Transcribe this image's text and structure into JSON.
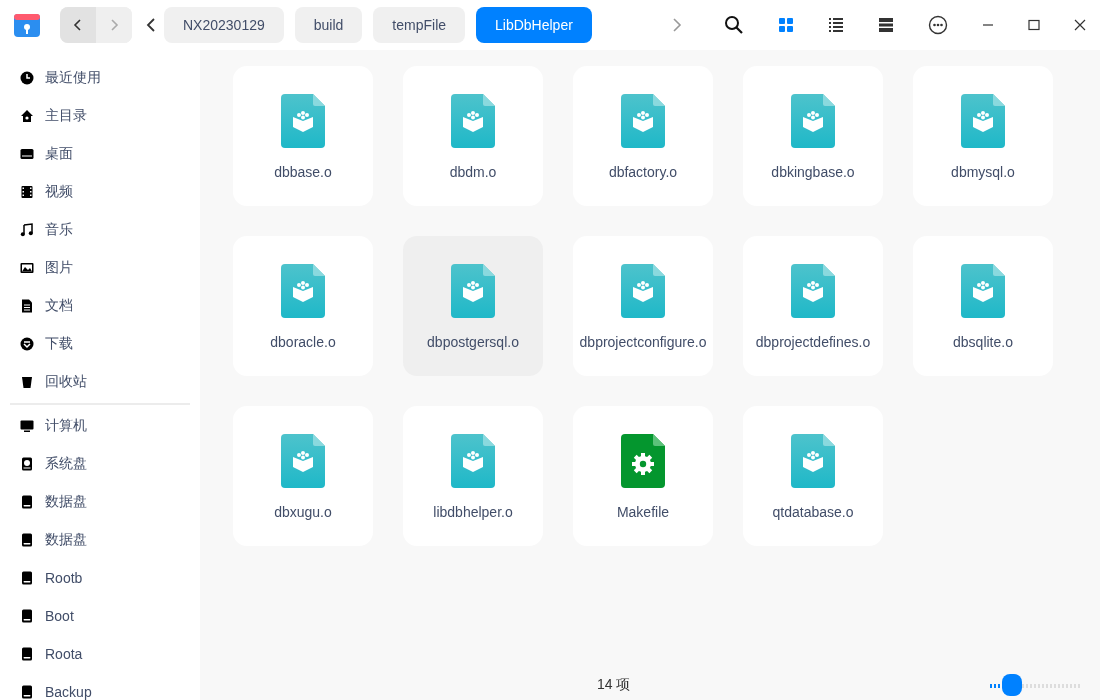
{
  "nav": {
    "back_disabled": false,
    "forward_disabled": true
  },
  "breadcrumbs": [
    {
      "label": "NX20230129",
      "selected": false
    },
    {
      "label": "build",
      "selected": false
    },
    {
      "label": "tempFile",
      "selected": false
    },
    {
      "label": "LibDbHelper",
      "selected": true
    }
  ],
  "view_modes": [
    {
      "kind": "icons",
      "selected": true
    },
    {
      "kind": "list",
      "selected": false
    },
    {
      "kind": "tree",
      "selected": false
    }
  ],
  "sidebar": {
    "groups": [
      [
        {
          "label": "最近使用",
          "kind": "recent"
        },
        {
          "label": "主目录",
          "kind": "home"
        },
        {
          "label": "桌面",
          "kind": "desktop"
        },
        {
          "label": "视频",
          "kind": "video"
        },
        {
          "label": "音乐",
          "kind": "music"
        },
        {
          "label": "图片",
          "kind": "pictures"
        },
        {
          "label": "文档",
          "kind": "documents"
        },
        {
          "label": "下载",
          "kind": "downloads"
        },
        {
          "label": "回收站",
          "kind": "trash"
        }
      ],
      [
        {
          "label": "计算机",
          "kind": "computer"
        },
        {
          "label": "系统盘",
          "kind": "system-disk"
        },
        {
          "label": "数据盘",
          "kind": "disk"
        },
        {
          "label": "数据盘",
          "kind": "disk"
        },
        {
          "label": "Rootb",
          "kind": "disk"
        },
        {
          "label": "Boot",
          "kind": "disk"
        },
        {
          "label": "Roota",
          "kind": "disk"
        },
        {
          "label": "Backup",
          "kind": "disk"
        }
      ]
    ]
  },
  "files": [
    {
      "name": "dbbase.o",
      "kind": "object",
      "selected": false
    },
    {
      "name": "dbdm.o",
      "kind": "object",
      "selected": false
    },
    {
      "name": "dbfactory.o",
      "kind": "object",
      "selected": false
    },
    {
      "name": "dbkingbase.o",
      "kind": "object",
      "selected": false
    },
    {
      "name": "dbmysql.o",
      "kind": "object",
      "selected": false
    },
    {
      "name": "dboracle.o",
      "kind": "object",
      "selected": false
    },
    {
      "name": "dbpostgersql.o",
      "kind": "object",
      "selected": true
    },
    {
      "name": "dbprojectconfigure.o",
      "kind": "object",
      "selected": false
    },
    {
      "name": "dbprojectdefines.o",
      "kind": "object",
      "selected": false
    },
    {
      "name": "dbsqlite.o",
      "kind": "object",
      "selected": false
    },
    {
      "name": "dbxugu.o",
      "kind": "object",
      "selected": false
    },
    {
      "name": "libdbhelper.o",
      "kind": "object",
      "selected": false
    },
    {
      "name": "Makefile",
      "kind": "makefile",
      "selected": false
    },
    {
      "name": "qtdatabase.o",
      "kind": "object",
      "selected": false
    }
  ],
  "status_bar": {
    "item_count": "14 项"
  },
  "zoom_slider": {
    "level": 0.25
  }
}
